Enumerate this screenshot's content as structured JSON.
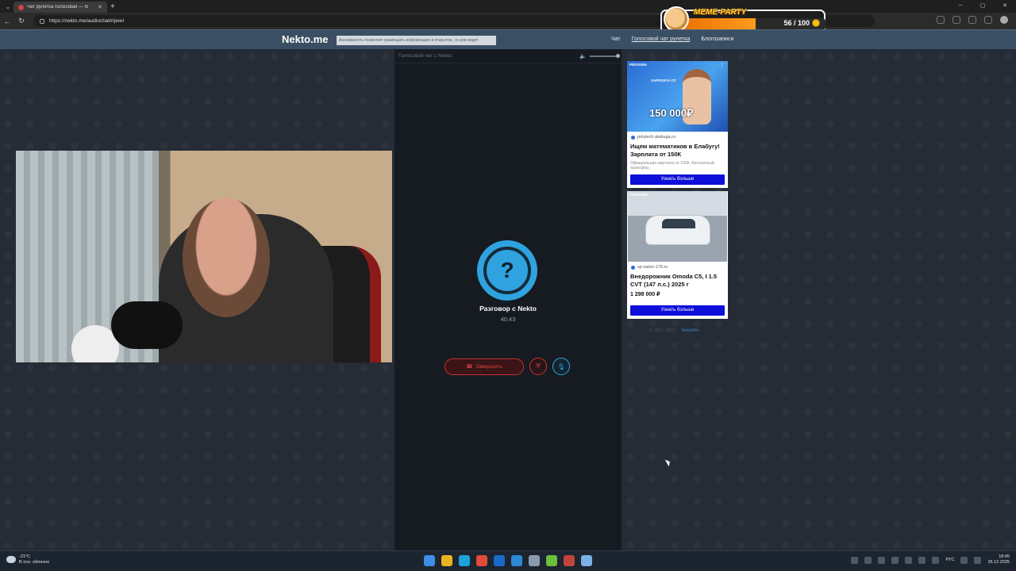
{
  "browser": {
    "tabs": [
      {
        "label": "Чат рулетка голосовая — N",
        "favicon_color": "#d94040"
      },
      {
        "label": "",
        "favicon_color": "#555555"
      }
    ],
    "new_tab": "+",
    "url": "https://nekto.me/audiochat#/peer"
  },
  "overlay": {
    "title": "MEME-PARTY",
    "progress_text": "56 / 100",
    "progress": 0.56
  },
  "site": {
    "logo": "Nekto.me",
    "notice": "Анонимность позволяет размещать информацию в открытом, со ром видят",
    "nav": [
      "Чат",
      "Голосовой чат рулетка",
      "Блогозаписи"
    ]
  },
  "chat": {
    "header": "Голосовой чат с Nekto",
    "volume": 1.0,
    "avatar_symbol": "?",
    "peer_name": "Разговор с Nekto",
    "timer": "40:43",
    "end_label": "Завершить"
  },
  "ads": [
    {
      "tag": "РЕКЛАМА",
      "banner_small": "ЗАРПЛАТА ОТ",
      "banner_big": "150 000₽",
      "domain": "polytech.alabuga.ru",
      "title": "Ищем математиков в Елабугу! Зарплата от 150К",
      "desc": "Официальная зарплата от 150К. Бесплатный трансфер.",
      "button": "Узнать больше"
    },
    {
      "tag": "РЕКЛАМА",
      "domain": "sp-salon-178.ru",
      "title": "Внедорожник Omoda C5, I 1.5 CVT (147 л.с.) 2025 г",
      "price": "1 298 000 ₽",
      "button": "Узнать больше"
    }
  ],
  "footer": {
    "copyright": "© 2011–2025",
    "link": "NektoMe"
  },
  "taskbar": {
    "temp": "-21°C",
    "weather": "В осн. облачно",
    "lang": "РУС",
    "time": "18:45",
    "date": "26.12.2025",
    "apps": [
      "#3d8ee6",
      "#e8b320",
      "#1aa3d8",
      "#e04b3a",
      "#1b6ac9",
      "#2a8ad6",
      "#8a9aae",
      "#6bbf3a",
      "#c2433a",
      "#7ab0e6"
    ]
  }
}
